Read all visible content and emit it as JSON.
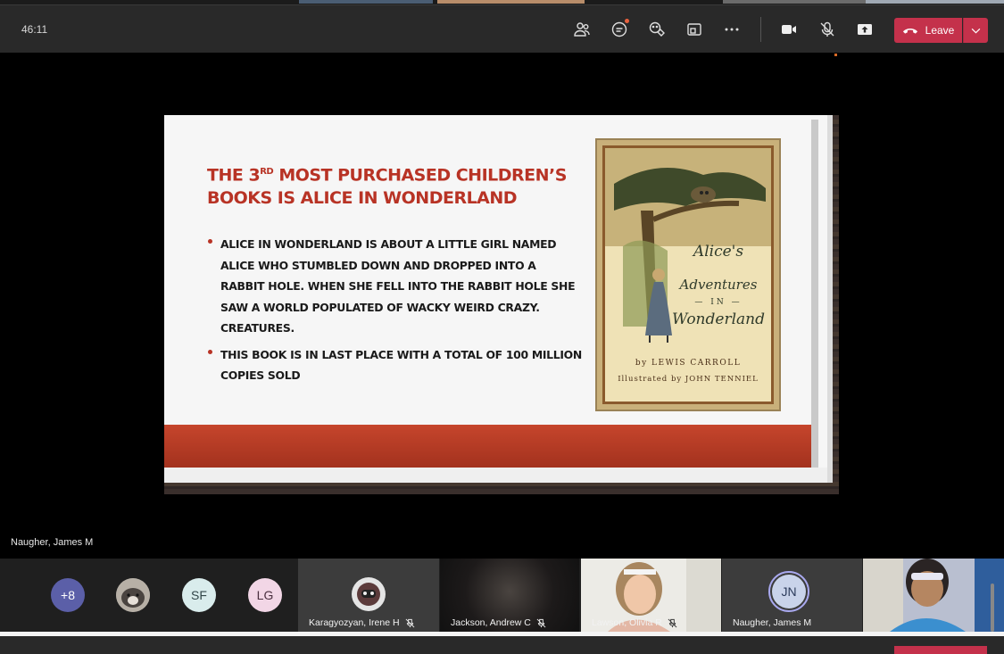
{
  "meeting": {
    "timer": "46:11",
    "leave_label": "Leave"
  },
  "toolbar_icons": [
    "people-icon",
    "chat-icon",
    "reactions-icon",
    "share-tray-icon",
    "more-icon",
    "camera-icon",
    "mic-muted-icon",
    "share-screen-icon"
  ],
  "slide": {
    "title_part1": "THE 3",
    "title_sup": "RD",
    "title_part2": " MOST PURCHASED CHILDREN’S",
    "title_line2": "BOOKS IS ALICE IN WONDERLAND",
    "bullets": [
      "ALICE IN WONDERLAND IS ABOUT A LITTLE GIRL NAMED ALICE WHO STUMBLED DOWN AND DROPPED INTO A RABBIT HOLE. WHEN SHE FELL INTO THE RABBIT HOLE SHE SAW A WORLD POPULATED  OF  WACKY WEIRD CRAZY. CREATURES.",
      "THIS BOOK IS IN LAST PLACE WITH A TOTAL OF 100 MILLION COPIES SOLD"
    ],
    "book": {
      "title_1": "Alice's",
      "title_2": "Adventures",
      "title_3": "— IN —",
      "title_4": "Wonderland",
      "author": "by LEWIS CARROLL",
      "illustrator": "Illustrated by JOHN TENNIEL"
    },
    "accent_color": "#b83325"
  },
  "presenter_label": "Naugher, James M",
  "participants": {
    "overflow_count": "+8",
    "avatars": [
      {
        "initials": "",
        "kind": "photo"
      },
      {
        "initials": "SF",
        "bg": "#d9ecec",
        "fg": "#33474a"
      },
      {
        "initials": "LG",
        "bg": "#f2d6e6",
        "fg": "#4a2f3f"
      }
    ],
    "tiles": [
      {
        "name": "Karagyozyan, Irene H"
      },
      {
        "name": "Jackson, Andrew C"
      },
      {
        "name": "Lawson, Olivia R"
      },
      {
        "name": "Naugher, James M",
        "initials": "JN"
      },
      {
        "name": ""
      }
    ]
  }
}
